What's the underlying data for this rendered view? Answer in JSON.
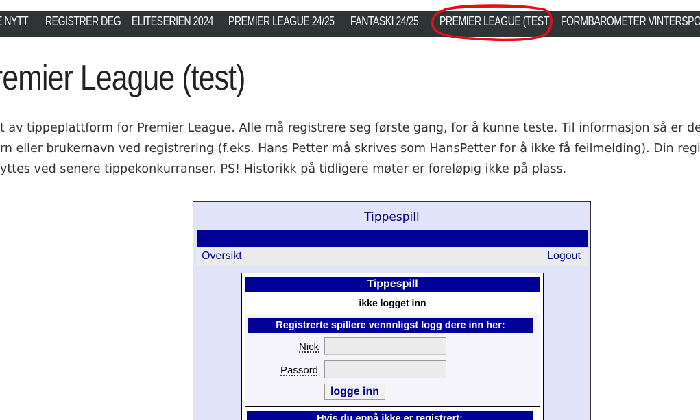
{
  "nav": {
    "items": [
      "E NYTT",
      "REGISTRER DEG",
      "ELITESERIEN 2024",
      "PREMIER LEAGUE 24/25",
      "FANTASKI 24/25",
      "PREMIER LEAGUE (TEST)",
      "FORMBAROMETER VINTERSPORT"
    ],
    "highlight_color": "#e0101a"
  },
  "page": {
    "title": "remier League (test)",
    "intro_lines": [
      "t av tippeplattform for Premier League. Alle må registrere seg første gang, for å kunne teste. Til informasjon så er det ik",
      "rn eller brukernavn ved registrering (f.eks. Hans Petter må skrives som HansPetter for å ikke få feilmelding). Din registre",
      "yttes ved senere tippekonkurranser. PS! Historikk på tidligere møter er foreløpig ikke på plass."
    ]
  },
  "widget": {
    "title": "Tippespill",
    "link_left": "Oversikt",
    "link_right": "Logout",
    "inner_title": "Tippespill",
    "status": "ikke logget inn",
    "login": {
      "header": "Registrerte spillere vennnligst logg dere inn her:",
      "nick_label": "Nick",
      "nick_value": "",
      "pass_label": "Passord",
      "pass_value": "",
      "button": "logge inn"
    },
    "register_header": "Hvis du ennå ikke er registrert:"
  },
  "colors": {
    "navbar": "#2f3437",
    "widget_bg": "#e1e4f8",
    "widget_blue": "#000099",
    "link_blue": "#000080"
  }
}
